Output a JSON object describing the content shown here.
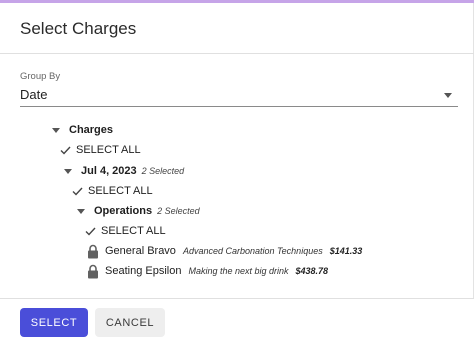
{
  "dialog": {
    "title": "Select Charges"
  },
  "group_by": {
    "label": "Group By",
    "value": "Date"
  },
  "tree": {
    "root_label": "Charges",
    "select_all_label": "SELECT ALL",
    "date_group": {
      "label": "Jul 4, 2023",
      "selected_count": "2 Selected"
    },
    "category": {
      "label": "Operations",
      "selected_count": "2 Selected"
    },
    "charges": [
      {
        "name": "General Bravo",
        "description": "Advanced Carbonation Techniques",
        "amount": "$141.33"
      },
      {
        "name": "Seating Epsilon",
        "description": "Making the next big drink",
        "amount": "$438.78"
      }
    ]
  },
  "buttons": {
    "select_label": "SELECT",
    "cancel_label": "CANCEL"
  },
  "colors": {
    "primary": "#4a4ed9",
    "secondary_bg": "#eeeeee",
    "accent_top": "#c6a4e8"
  },
  "icons": {
    "expanded": "caret-down-icon",
    "checked": "check-icon",
    "locked": "lock-icon"
  }
}
